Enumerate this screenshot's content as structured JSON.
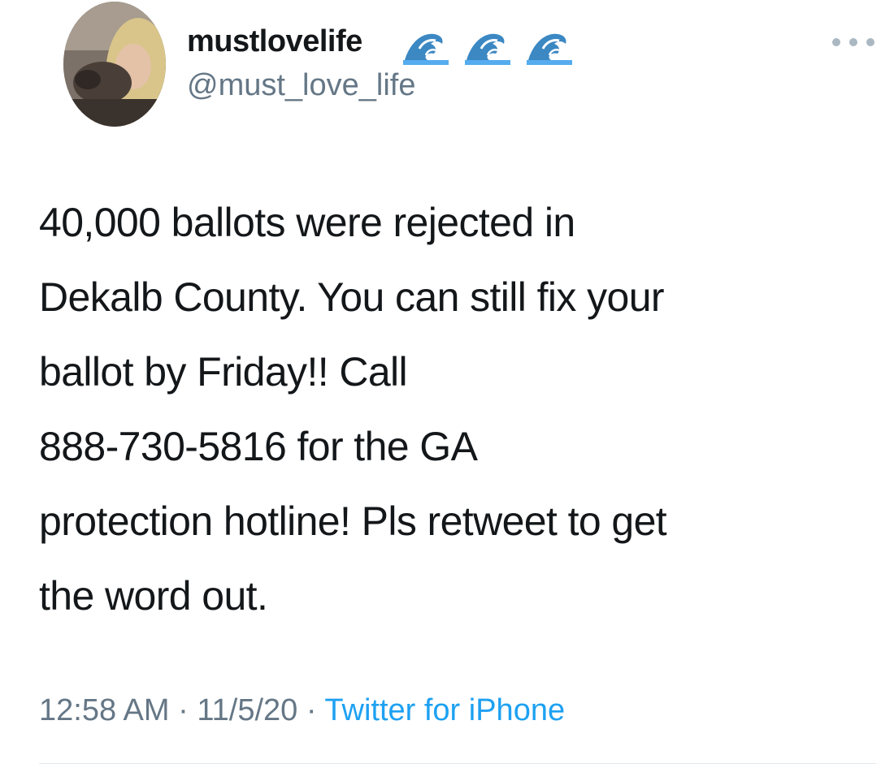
{
  "tweet": {
    "author": {
      "display_name": "mustlovelife",
      "name_emojis": [
        "wave-icon",
        "wave-icon",
        "wave-icon"
      ],
      "handle": "@must_love_life"
    },
    "text_lines": [
      "40,000 ballots were rejected in",
      "Dekalb County. You can still fix your",
      "ballot by Friday!! Call",
      "888-730-5816 for the GA",
      "protection hotline! Pls retweet to get",
      "the word out."
    ],
    "time": "12:58 AM",
    "separator": " · ",
    "date": "11/5/20",
    "source": "Twitter for iPhone"
  },
  "colors": {
    "text": "#14171a",
    "secondary": "#657786",
    "link": "#1da1f2",
    "divider": "#e1e8ed"
  }
}
